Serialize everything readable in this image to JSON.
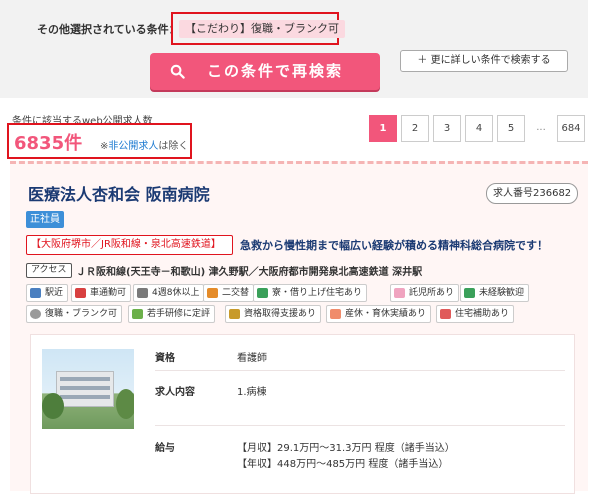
{
  "search": {
    "other_conditions_label": "その他選択されている条件：",
    "condition_tag": "【こだわり】復職・ブランク可",
    "research_button": "この条件で再検索",
    "detail_button": "＋ 更に詳しい条件で検索する"
  },
  "results": {
    "caption": "条件に該当するweb公開求人数",
    "count": "6835件",
    "note_prefix": "※",
    "note_highlight": "非公開求人",
    "note_suffix": "は除く"
  },
  "pagination": {
    "pages": [
      "1",
      "2",
      "3",
      "4",
      "5"
    ],
    "ellipsis": "...",
    "last": "684",
    "current": "1"
  },
  "job": {
    "name": "医療法人杏和会 阪南病院",
    "job_number": "求人番号236682",
    "employment_type": "正社員",
    "area": "【大阪府堺市／JR阪和線・泉北高速鉄道】",
    "catchphrase": "急救から慢性期まで幅広い経験が積める精神科総合病院です！",
    "access_label": "アクセス",
    "access": "ＪＲ阪和線(天王寺－和歌山) 津久野駅／大阪府都市開発泉北高速鉄道 深井駅",
    "features": [
      {
        "label": "駅近",
        "icon": "train-icon",
        "color": "#4a7fc0"
      },
      {
        "label": "車通勤可",
        "icon": "car-icon",
        "color": "#d84040"
      },
      {
        "label": "4週8休以上",
        "icon": "calendar-icon",
        "color": "#7a7a7a"
      },
      {
        "label": "二交替",
        "icon": "shift-icon",
        "color": "#e58c2a"
      },
      {
        "label": "寮・借り上げ住宅あり",
        "icon": "house-icon",
        "color": "#3aa05a"
      },
      {
        "label": "託児所あり",
        "icon": "baby-bottle-icon",
        "color": "#f0a4c0"
      },
      {
        "label": "未経験歓迎",
        "icon": "beginner-icon",
        "color": "#3aa05a"
      },
      {
        "label": "復職・ブランク可",
        "icon": "clock-icon",
        "color": "#9a9a9a"
      },
      {
        "label": "若手研修に定評",
        "icon": "sprout-icon",
        "color": "#6cb04a"
      },
      {
        "label": "資格取得支援あり",
        "icon": "certificate-icon",
        "color": "#c89a2a"
      },
      {
        "label": "産休・育休実績あり",
        "icon": "maternity-icon",
        "color": "#f08c6c"
      },
      {
        "label": "住宅補助あり",
        "icon": "house-support-icon",
        "color": "#e05a5a"
      }
    ],
    "details": [
      {
        "label": "資格",
        "value": "看護師"
      },
      {
        "label": "求人内容",
        "value": "1.病棟"
      },
      {
        "label": "給与",
        "value": "【月収】29.1万円～31.3万円 程度（諸手当込）",
        "value2": "【年収】448万円～485万円 程度（諸手当込）"
      }
    ]
  }
}
